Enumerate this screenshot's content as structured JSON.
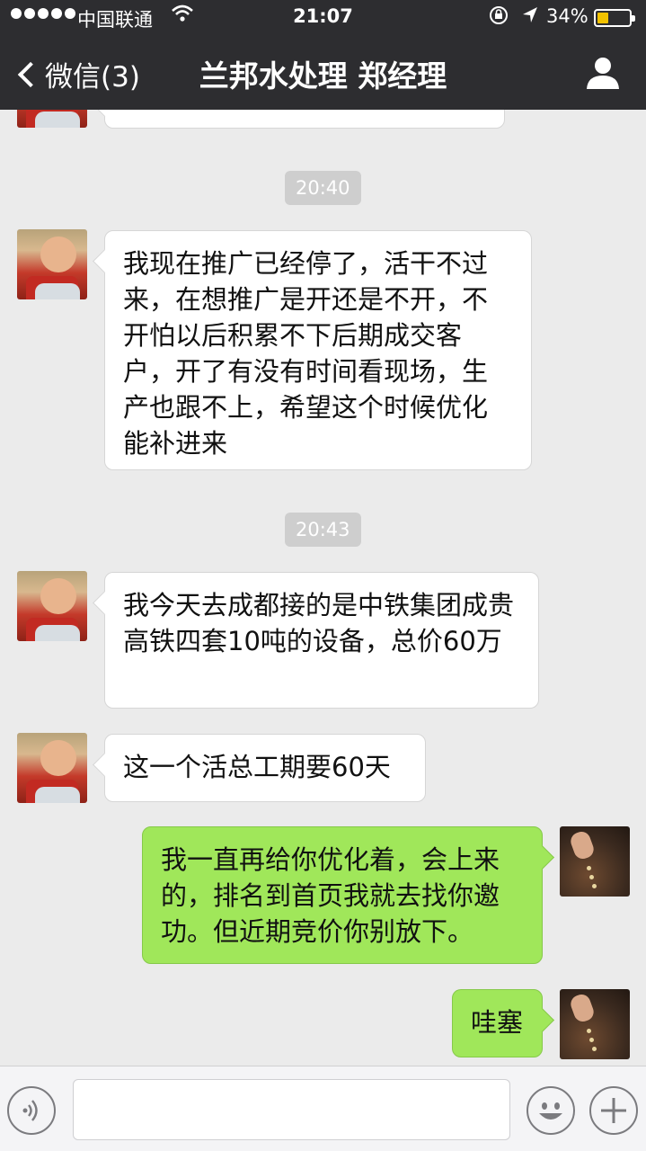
{
  "status_bar": {
    "carrier": "中国联通",
    "time": "21:07",
    "battery_percent": "34%",
    "battery_level": 0.34,
    "icons": [
      "signal-dots-icon",
      "wifi-icon",
      "rotation-lock-icon",
      "location-arrow-icon",
      "battery-icon"
    ]
  },
  "nav": {
    "back_label": "微信(3)",
    "title": "兰邦水处理 郑经理",
    "icons": [
      "chevron-left-icon",
      "person-icon"
    ]
  },
  "messages": [
    {
      "type": "timestamp",
      "text": "20:40"
    },
    {
      "type": "message",
      "sender": "them",
      "text": "我现在推广已经停了，活干不过来，在想推广是开还是不开，不开怕以后积累不下后期成交客户，开了有没有时间看现场，生产也跟不上，希望这个时候优化能补进来"
    },
    {
      "type": "timestamp",
      "text": "20:43"
    },
    {
      "type": "message",
      "sender": "them",
      "text": "我今天去成都接的是中铁集团成贵高铁四套10吨的设备，总价60万"
    },
    {
      "type": "message",
      "sender": "them",
      "text": "这一个活总工期要60天"
    },
    {
      "type": "message",
      "sender": "me",
      "text": "我一直再给你优化着，会上来的，排名到首页我就去找你邀功。但近期竞价你别放下。"
    },
    {
      "type": "message",
      "sender": "me",
      "text": "哇塞"
    }
  ],
  "input_bar": {
    "icons": [
      "voice-icon",
      "emoji-icon",
      "plus-icon"
    ],
    "text_value": ""
  },
  "colors": {
    "nav_background": "#2d2d30",
    "chat_background": "#ebebeb",
    "my_bubble": "#a0e75a",
    "their_bubble": "#ffffff",
    "timestamp_pill": "#cecece",
    "battery_fill": "#f2c200"
  }
}
